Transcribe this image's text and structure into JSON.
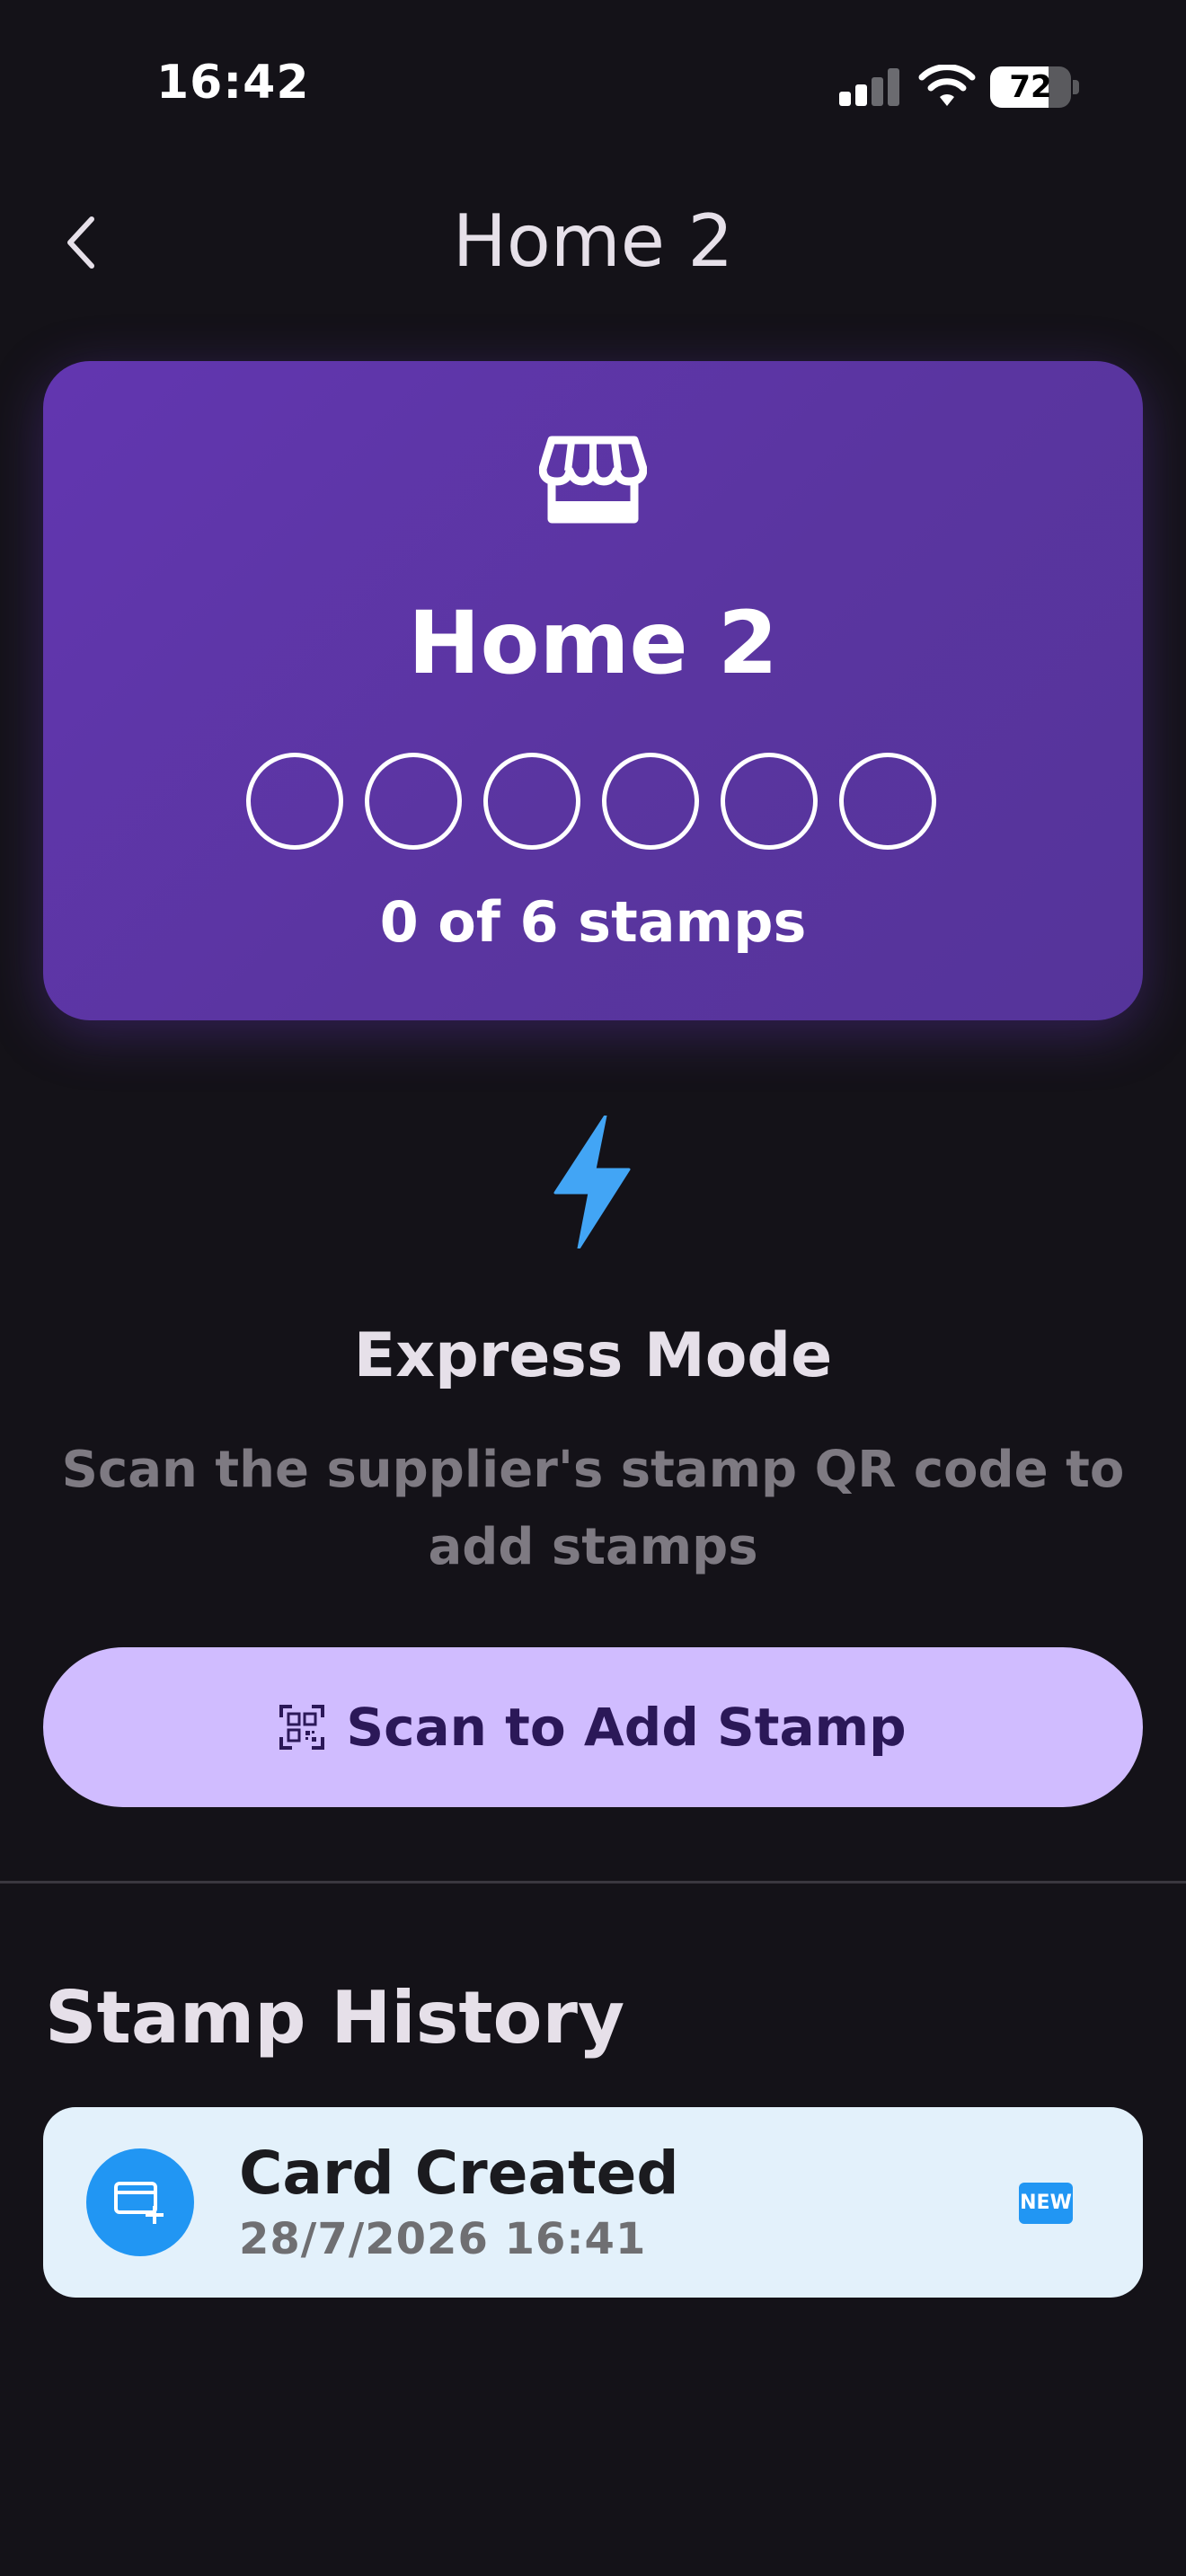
{
  "status_bar": {
    "time": "16:42",
    "battery_percent": 72
  },
  "app_bar": {
    "title": "Home 2",
    "back_icon": "chevron-left-icon"
  },
  "stamp_card": {
    "icon": "storefront-icon",
    "title": "Home 2",
    "stamps_total": 6,
    "stamps_collected": 0,
    "stamp_count_text": "0 of 6 stamps",
    "gradient_color": "#5E35A8"
  },
  "express_mode": {
    "icon": "lightning-bolt-icon",
    "icon_color": "#42A5F5",
    "title": "Express Mode",
    "description": "Scan the supplier's stamp QR code to add stamps"
  },
  "scan_button": {
    "icon": "qr-code-scan-icon",
    "label": "Scan to Add Stamp",
    "background": "#D0BCFF"
  },
  "stamp_history": {
    "title": "Stamp History",
    "items": [
      {
        "icon": "card-add-icon",
        "title": "Card Created",
        "date": "28/7/2026 16:41",
        "badge": "NEW",
        "accent": "#2196F3"
      }
    ]
  }
}
